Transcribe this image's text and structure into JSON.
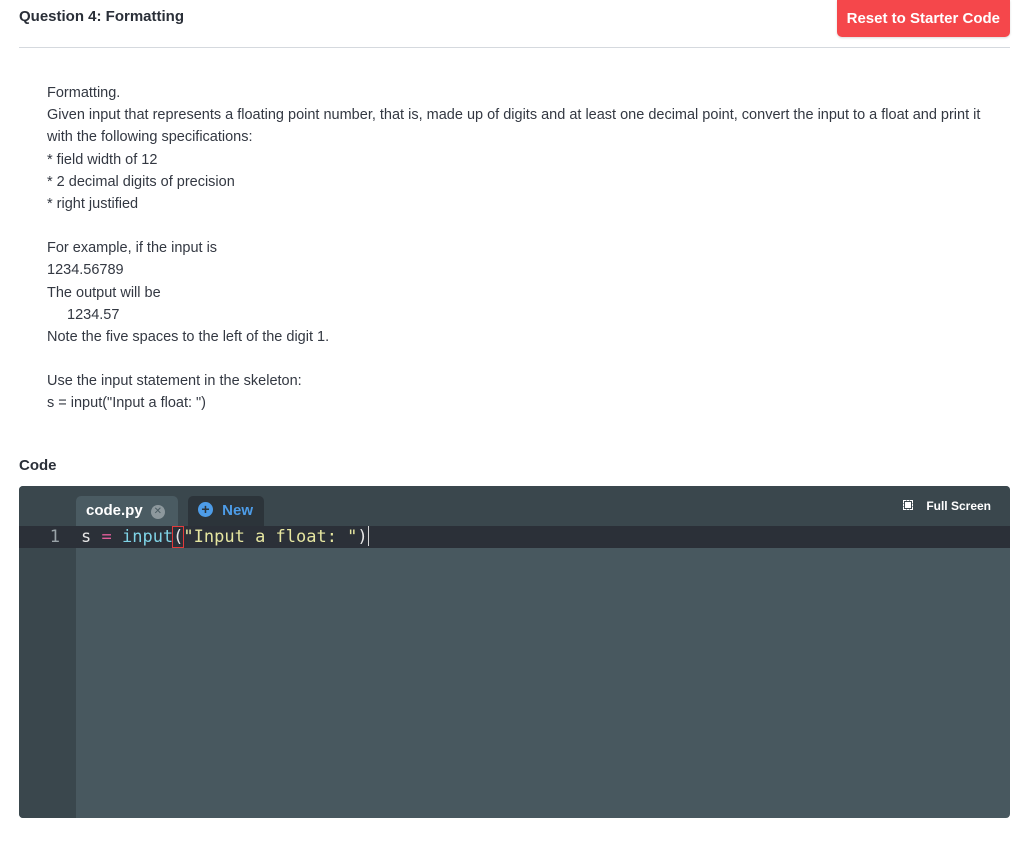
{
  "header": {
    "title": "Question 4: Formatting",
    "reset_label": "Reset to Starter Code"
  },
  "prompt": {
    "lines_1": [
      "Formatting.",
      "Given input that represents a floating point number, that is, made up of digits and at least one decimal point, convert the input to a float and print it with the following specifications:",
      "* field width of 12",
      "* 2 decimal digits of precision",
      "* right justified"
    ],
    "example_intro": "For example, if the input is",
    "example_input": "1234.56789",
    "output_intro": "The output will be",
    "example_output": "1234.57",
    "note": "Note the five spaces to the left of the digit 1.",
    "skeleton_intro": "Use the input statement in the skeleton:",
    "skeleton_code": "s = input(\"Input a float: \")"
  },
  "code_section": {
    "label": "Code"
  },
  "editor": {
    "tabs": [
      {
        "label": "code.py",
        "active": true
      },
      {
        "label": "New",
        "active": false
      }
    ],
    "fullscreen_label": "Full Screen",
    "lines": [
      {
        "number": "1",
        "tokens": {
          "var": "s ",
          "op": "=",
          "sp": " ",
          "fn": "input",
          "lparen": "(",
          "str": "\"Input a float: \"",
          "rparen": ")"
        }
      }
    ]
  },
  "colors": {
    "accent_red": "#f5474b",
    "new_tab_blue": "#4d9ce8",
    "editor_bg": "#48585f",
    "gutter_bg": "#3a474d",
    "active_line_bg": "#2b3038"
  }
}
